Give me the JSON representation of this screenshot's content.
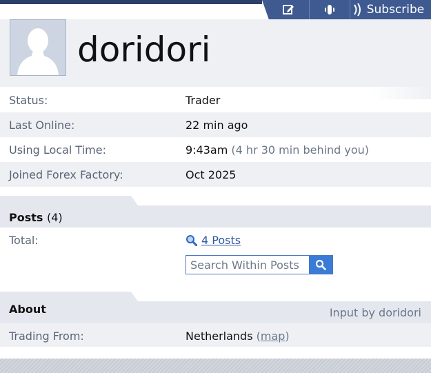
{
  "toolbar": {
    "edit_icon": "edit-note-icon",
    "follow_icon": "follow-icon",
    "subscribe_label": "Subscribe",
    "accent": "#3f5a91"
  },
  "profile": {
    "username": "doridori",
    "avatar_icon": "default-avatar-silhouette"
  },
  "info": {
    "status": {
      "label": "Status:",
      "value": "Trader"
    },
    "last_online": {
      "label": "Last Online:",
      "value": "22 min ago"
    },
    "local_time": {
      "label": "Using Local Time:",
      "value": "9:43am",
      "note": "(4 hr 30 min behind you)"
    },
    "joined": {
      "label": "Joined Forex Factory:",
      "value": "Oct 2025"
    }
  },
  "posts": {
    "title": "Posts",
    "count": "(4)",
    "total_label": "Total:",
    "posts_link": "4 Posts",
    "search_placeholder": "Search Within Posts"
  },
  "about": {
    "title": "About",
    "input_by": "Input by doridori",
    "trading_from_label": "Trading From:",
    "trading_from_value": "Netherlands",
    "map_open": "(",
    "map_link": "map",
    "map_close": ")"
  }
}
